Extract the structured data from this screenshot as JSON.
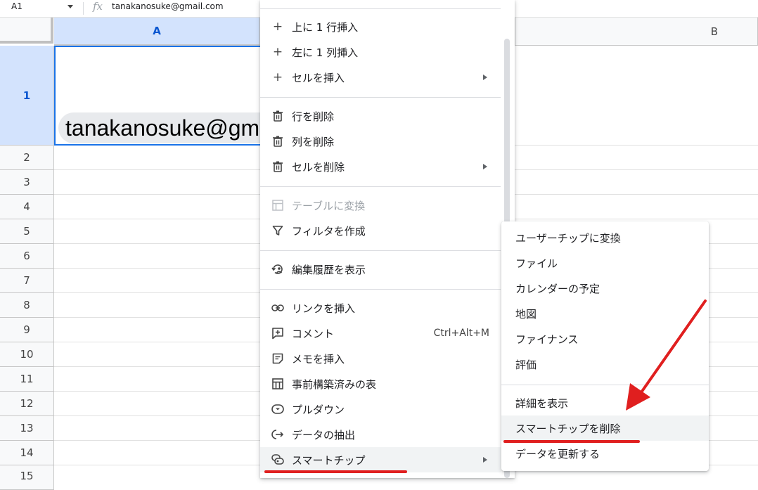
{
  "formula_bar": {
    "name_box": "A1",
    "fx": "fx",
    "value": "tanakanosuke@gmail.com"
  },
  "columns": {
    "a": "A",
    "b": "B"
  },
  "rows": [
    "1",
    "2",
    "3",
    "4",
    "5",
    "6",
    "7",
    "8",
    "9",
    "10",
    "11",
    "12",
    "13",
    "14",
    "15"
  ],
  "cell_a1": {
    "chip_text": "tanakanosuke@gmail.com"
  },
  "context_menu": {
    "items": [
      {
        "label": "上に 1 行挿入",
        "icon": "plus-icon"
      },
      {
        "label": "左に 1 列挿入",
        "icon": "plus-icon"
      },
      {
        "label": "セルを挿入",
        "icon": "plus-icon"
      },
      {
        "label": "行を削除",
        "icon": "trash-icon"
      },
      {
        "label": "列を削除",
        "icon": "trash-icon"
      },
      {
        "label": "セルを削除",
        "icon": "trash-icon"
      },
      {
        "label": "テーブルに変換",
        "icon": "table-icon"
      },
      {
        "label": "フィルタを作成",
        "icon": "filter-icon"
      },
      {
        "label": "編集履歴を表示",
        "icon": "history-icon"
      },
      {
        "label": "リンクを挿入",
        "icon": "link-icon"
      },
      {
        "label": "コメント",
        "icon": "comment-icon",
        "shortcut": "Ctrl+Alt+M"
      },
      {
        "label": "メモを挿入",
        "icon": "note-icon"
      },
      {
        "label": "事前構築済みの表",
        "icon": "table-template-icon"
      },
      {
        "label": "プルダウン",
        "icon": "dropdown-icon"
      },
      {
        "label": "データの抽出",
        "icon": "extract-icon"
      },
      {
        "label": "スマートチップ",
        "icon": "smart-chip-icon"
      }
    ]
  },
  "submenu": {
    "items": [
      "ユーザーチップに変換",
      "ファイル",
      "カレンダーの予定",
      "地図",
      "ファイナンス",
      "評価",
      "詳細を表示",
      "スマートチップを削除",
      "データを更新する"
    ]
  },
  "colors": {
    "selection_blue": "#d3e3fd",
    "accent_blue": "#0b57d0",
    "annotation_red": "#e01f1f",
    "hover_gray": "#f1f3f4"
  }
}
